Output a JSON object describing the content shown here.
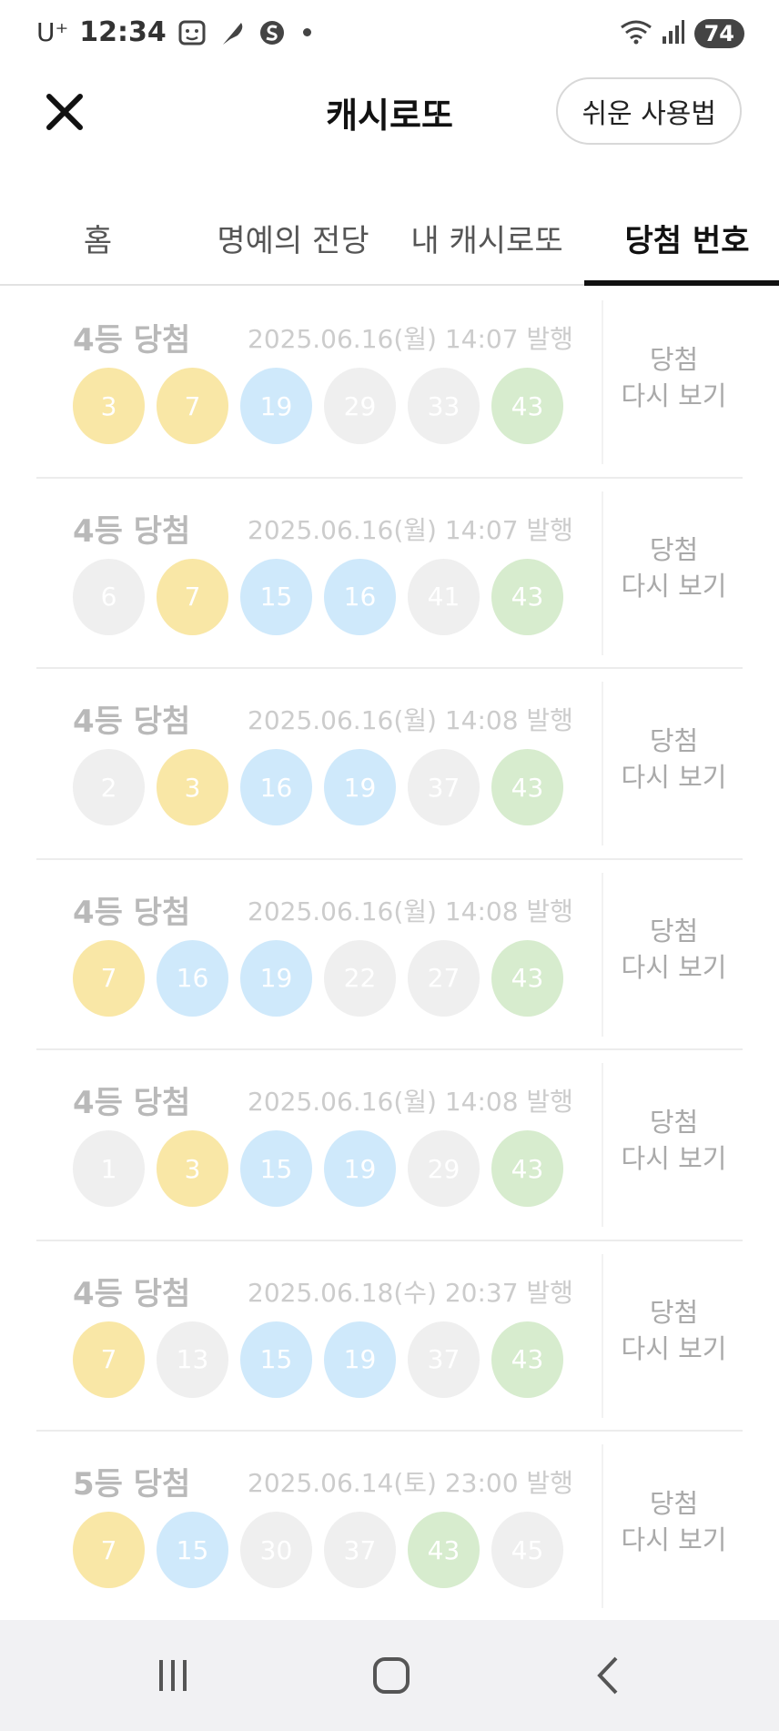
{
  "status_bar": {
    "carrier": "U⁺",
    "time": "12:34",
    "battery": "74",
    "icons": [
      "face-id-icon",
      "feather-icon",
      "s-app-icon",
      "notification-dot-icon",
      "wifi-icon",
      "signal-icon",
      "battery-icon"
    ]
  },
  "header": {
    "title": "캐시로또",
    "close_icon": "close-icon",
    "guide_label": "쉬운 사용법"
  },
  "tabs": [
    {
      "label": "홈",
      "active": false
    },
    {
      "label": "명예의 전당",
      "active": false
    },
    {
      "label": "내 캐시로또",
      "active": false
    },
    {
      "label": "당첨 번호",
      "active": true
    }
  ],
  "items": [
    {
      "rank": "4등 당첨",
      "issued": "2025.06.16(월) 14:07 발행",
      "numbers": [
        "3",
        "7",
        "19",
        "29",
        "33",
        "43"
      ],
      "colors": [
        "yellow",
        "yellow",
        "blue",
        "gray",
        "gray",
        "green"
      ],
      "action_line1": "당첨",
      "action_line2": "다시 보기"
    },
    {
      "rank": "4등 당첨",
      "issued": "2025.06.16(월) 14:07 발행",
      "numbers": [
        "6",
        "7",
        "15",
        "16",
        "41",
        "43"
      ],
      "colors": [
        "gray",
        "yellow",
        "blue",
        "blue",
        "gray",
        "green"
      ],
      "action_line1": "당첨",
      "action_line2": "다시 보기"
    },
    {
      "rank": "4등 당첨",
      "issued": "2025.06.16(월) 14:08 발행",
      "numbers": [
        "2",
        "3",
        "16",
        "19",
        "37",
        "43"
      ],
      "colors": [
        "gray",
        "yellow",
        "blue",
        "blue",
        "gray",
        "green"
      ],
      "action_line1": "당첨",
      "action_line2": "다시 보기"
    },
    {
      "rank": "4등 당첨",
      "issued": "2025.06.16(월) 14:08 발행",
      "numbers": [
        "7",
        "16",
        "19",
        "22",
        "27",
        "43"
      ],
      "colors": [
        "yellow",
        "blue",
        "blue",
        "gray",
        "gray",
        "green"
      ],
      "action_line1": "당첨",
      "action_line2": "다시 보기"
    },
    {
      "rank": "4등 당첨",
      "issued": "2025.06.16(월) 14:08 발행",
      "numbers": [
        "1",
        "3",
        "15",
        "19",
        "29",
        "43"
      ],
      "colors": [
        "gray",
        "yellow",
        "blue",
        "blue",
        "gray",
        "green"
      ],
      "action_line1": "당첨",
      "action_line2": "다시 보기"
    },
    {
      "rank": "4등 당첨",
      "issued": "2025.06.18(수) 20:37 발행",
      "numbers": [
        "7",
        "13",
        "15",
        "19",
        "37",
        "43"
      ],
      "colors": [
        "yellow",
        "gray",
        "blue",
        "blue",
        "gray",
        "green"
      ],
      "action_line1": "당첨",
      "action_line2": "다시 보기"
    },
    {
      "rank": "5등 당첨",
      "issued": "2025.06.14(토) 23:00 발행",
      "numbers": [
        "7",
        "15",
        "30",
        "37",
        "43",
        "45"
      ],
      "colors": [
        "yellow",
        "blue",
        "gray",
        "gray",
        "green",
        "gray"
      ],
      "action_line1": "당첨",
      "action_line2": "다시 보기"
    }
  ],
  "nav_bar": {
    "buttons": [
      "recent-apps-icon",
      "home-icon",
      "back-icon"
    ]
  },
  "colors": {
    "ball_yellow": "#f9e7a6",
    "ball_blue": "#cfe9fb",
    "ball_gray": "#efefef",
    "ball_green": "#d7ecce",
    "tab_indicator": "#111111"
  }
}
